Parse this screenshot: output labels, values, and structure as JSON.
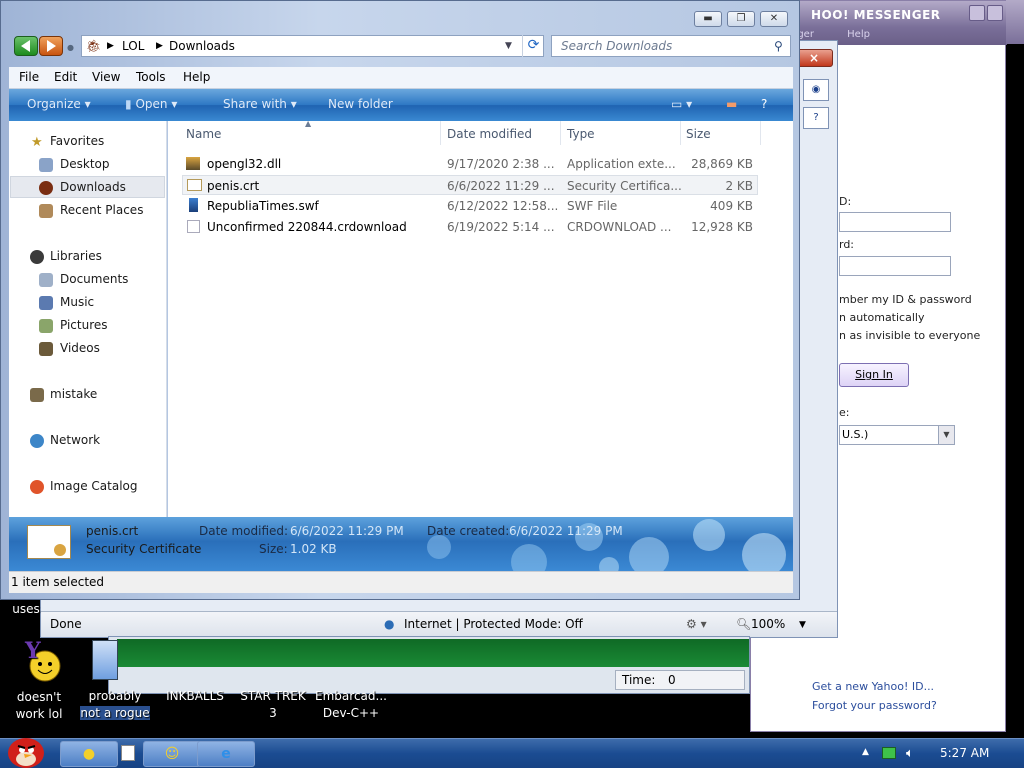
{
  "yahoo": {
    "title": "HOO! MESSENGER",
    "menu": [
      "nger",
      "Help"
    ],
    "id_label": "D:",
    "pw_label": "rd:",
    "remember": "mber my ID & password",
    "auto": "n automatically",
    "invisible": "n as invisible to everyone",
    "sign_in": "Sign In",
    "lang_label": "e:",
    "lang_value": "U.S.)",
    "get_id": "Get a new Yahoo! ID...",
    "forgot": "Forgot your password?"
  },
  "ie": {
    "status_text": "Done",
    "zone": "Internet | Protected Mode: Off",
    "zoom": "100%"
  },
  "game": {
    "time_label": "Time:",
    "time_value": "0"
  },
  "desktop": {
    "icons": [
      {
        "line1": "uses",
        "line2": ""
      },
      {
        "line1": "doesn't",
        "line2": "work lol"
      },
      {
        "line1": "probably",
        "line2": "not a rogue"
      },
      {
        "line1": "INKBALLS",
        "line2": ""
      },
      {
        "line1": "STAR TREK",
        "line2": "3"
      },
      {
        "line1": "Embarcad...",
        "line2": "Dev-C++"
      }
    ]
  },
  "explorer": {
    "breadcrumb": [
      "LOL",
      "Downloads"
    ],
    "search_placeholder": "Search Downloads",
    "menu": [
      "File",
      "Edit",
      "View",
      "Tools",
      "Help"
    ],
    "commands": [
      "Organize",
      "Open",
      "Share with",
      "New folder"
    ],
    "nav": {
      "favorites": "Favorites",
      "desktop": "Desktop",
      "downloads": "Downloads",
      "recent": "Recent Places",
      "libraries": "Libraries",
      "documents": "Documents",
      "music": "Music",
      "pictures": "Pictures",
      "videos": "Videos",
      "mistake": "mistake",
      "network": "Network",
      "catalog": "Image Catalog"
    },
    "columns": {
      "name": "Name",
      "date": "Date modified",
      "type": "Type",
      "size": "Size"
    },
    "files": [
      {
        "name": "opengl32.dll",
        "date": "9/17/2020 2:38 ...",
        "type": "Application exte...",
        "size": "28,869 KB"
      },
      {
        "name": "penis.crt",
        "date": "6/6/2022 11:29 ...",
        "type": "Security Certifica...",
        "size": "2 KB"
      },
      {
        "name": "RepubliaTimes.swf",
        "date": "6/12/2022 12:58...",
        "type": "SWF File",
        "size": "409 KB"
      },
      {
        "name": "Unconfirmed 220844.crdownload",
        "date": "6/19/2022 5:14 ...",
        "type": "CRDOWNLOAD ...",
        "size": "12,928 KB"
      }
    ],
    "details": {
      "name": "penis.crt",
      "type": "Security Certificate",
      "modified_label": "Date modified:",
      "modified_value": "6/6/2022 11:29 PM",
      "created_label": "Date created:",
      "created_value": "6/6/2022 11:29 PM",
      "size_label": "Size:",
      "size_value": "1.02 KB"
    },
    "status": "1 item selected"
  },
  "taskbar": {
    "clock": "5:27 AM"
  }
}
